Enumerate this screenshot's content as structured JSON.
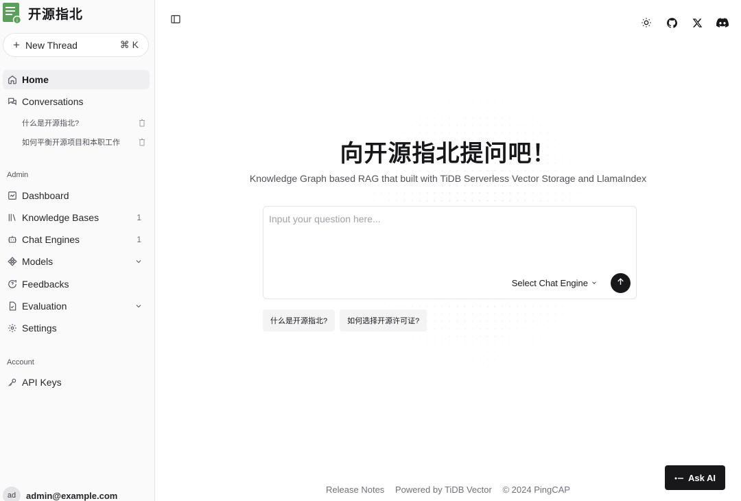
{
  "brand": {
    "name": "开源指北"
  },
  "sidebar": {
    "new_thread": {
      "label": "New Thread",
      "shortcut": "⌘ K"
    },
    "main_items": [
      {
        "label": "Home",
        "icon": "home-icon",
        "active": true
      },
      {
        "label": "Conversations",
        "icon": "messages-icon"
      }
    ],
    "conversations": [
      {
        "title": "什么是开源指北?"
      },
      {
        "title": "如何平衡开源项目和本职工作"
      }
    ],
    "admin_label": "Admin",
    "admin_items": [
      {
        "label": "Dashboard",
        "icon": "dashboard-icon"
      },
      {
        "label": "Knowledge Bases",
        "icon": "library-icon",
        "count": "1"
      },
      {
        "label": "Chat Engines",
        "icon": "bot-icon",
        "count": "1"
      },
      {
        "label": "Models",
        "icon": "models-icon",
        "expandable": true
      },
      {
        "label": "Feedbacks",
        "icon": "feedback-icon"
      },
      {
        "label": "Evaluation",
        "icon": "evaluation-icon",
        "expandable": true
      },
      {
        "label": "Settings",
        "icon": "gear-icon"
      }
    ],
    "account_label": "Account",
    "account_items": [
      {
        "label": "API Keys",
        "icon": "key-icon"
      }
    ],
    "user": {
      "initials": "ad",
      "email": "admin@example.com"
    }
  },
  "header_icons": [
    "sun-icon",
    "github-icon",
    "x-icon",
    "discord-icon"
  ],
  "main": {
    "headline": "向开源指北提问吧！",
    "subhead": "Knowledge Graph based RAG that built with TiDB Serverless Vector Storage and LlamaIndex",
    "ask": {
      "placeholder": "Input your question here...",
      "engine_label": "Select Chat Engine"
    },
    "suggestions": [
      "什么是开源指北?",
      "如何选择开源许可证?"
    ]
  },
  "footer": {
    "links": [
      "Release Notes",
      "Powered by TiDB Vector",
      "© 2024 PingCAP"
    ]
  },
  "ask_ai": {
    "label": "Ask AI"
  },
  "colors": {
    "primary": "#18181b",
    "sidebar_bg": "#fafafa",
    "logo_green": "#5aa05a"
  }
}
